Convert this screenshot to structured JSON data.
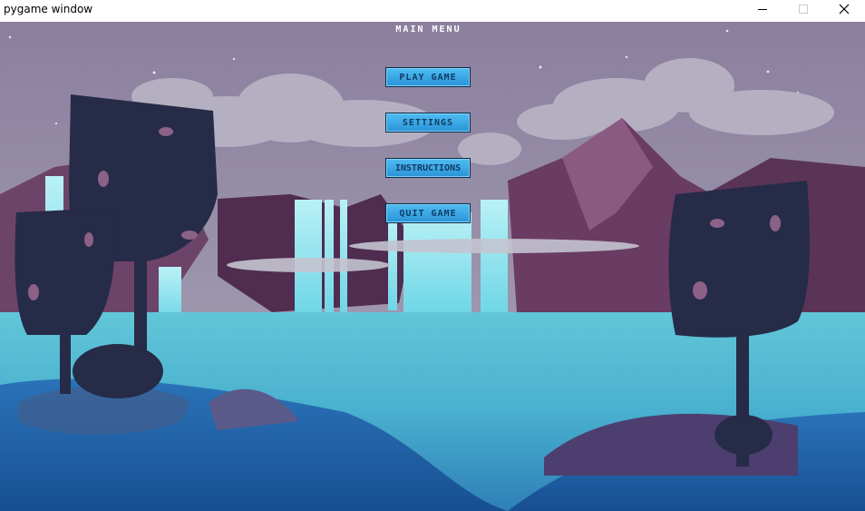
{
  "window": {
    "title": "pygame window",
    "controls": {
      "minimize_icon": "minimize-icon",
      "maximize_icon": "maximize-icon",
      "close_icon": "close-icon"
    }
  },
  "menu": {
    "title": "MAIN MENU",
    "buttons": {
      "play": "PLAY GAME",
      "settings": "SETTINGS",
      "instructions": "INSTRUCTIONS",
      "quit": "QUIT GAME"
    }
  },
  "colors": {
    "sky": "#8f86a3",
    "button_fill": "#3aa8e6",
    "button_text": "#123a63",
    "water": "#3fb8d0",
    "mountain": "#5c3a5f",
    "tree": "#262b48"
  }
}
